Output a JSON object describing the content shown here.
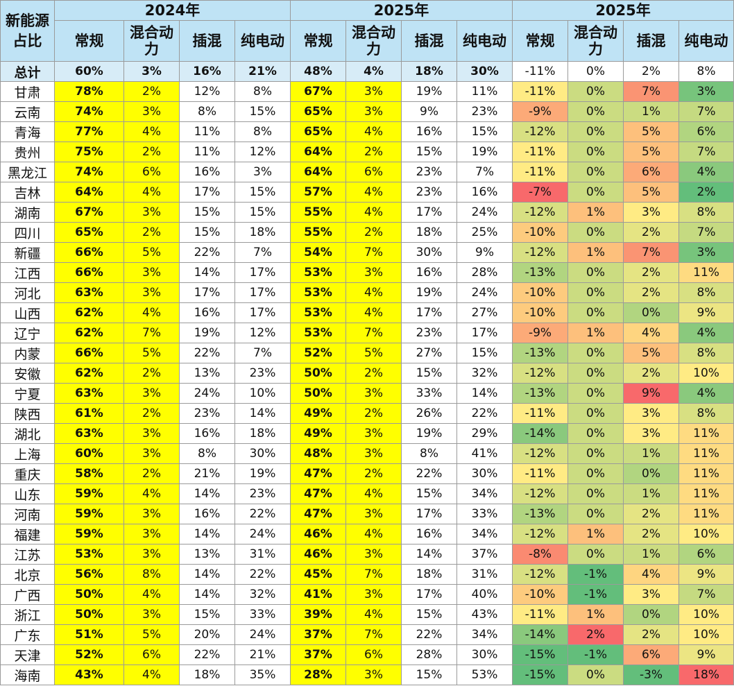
{
  "table": {
    "corner_label": "新能源占比",
    "group_headers": [
      "2024年",
      "2025年",
      "2025年"
    ],
    "sub_headers": [
      "常规",
      "混合动力",
      "插混",
      "纯电动",
      "常规",
      "混合动力",
      "插混",
      "纯电动",
      "常规",
      "混合动力",
      "插混",
      "纯电动"
    ],
    "total": {
      "label": "总计",
      "values": [
        "60%",
        "3%",
        "16%",
        "21%",
        "48%",
        "4%",
        "18%",
        "30%",
        "-11%",
        "0%",
        "2%",
        "8%"
      ]
    },
    "rows": [
      {
        "province": "甘肃",
        "values": [
          "78%",
          "2%",
          "12%",
          "8%",
          "67%",
          "3%",
          "19%",
          "11%",
          "-11%",
          "0%",
          "7%",
          "3%"
        ]
      },
      {
        "province": "云南",
        "values": [
          "74%",
          "3%",
          "8%",
          "15%",
          "65%",
          "3%",
          "9%",
          "23%",
          "-9%",
          "0%",
          "1%",
          "7%"
        ]
      },
      {
        "province": "青海",
        "values": [
          "77%",
          "4%",
          "11%",
          "8%",
          "65%",
          "4%",
          "16%",
          "15%",
          "-12%",
          "0%",
          "5%",
          "6%"
        ]
      },
      {
        "province": "贵州",
        "values": [
          "75%",
          "2%",
          "11%",
          "12%",
          "64%",
          "2%",
          "15%",
          "19%",
          "-11%",
          "0%",
          "5%",
          "7%"
        ]
      },
      {
        "province": "黑龙江",
        "values": [
          "74%",
          "6%",
          "16%",
          "3%",
          "64%",
          "6%",
          "23%",
          "7%",
          "-11%",
          "0%",
          "6%",
          "4%"
        ]
      },
      {
        "province": "吉林",
        "values": [
          "64%",
          "4%",
          "17%",
          "15%",
          "57%",
          "4%",
          "23%",
          "16%",
          "-7%",
          "0%",
          "5%",
          "2%"
        ]
      },
      {
        "province": "湖南",
        "values": [
          "67%",
          "3%",
          "15%",
          "15%",
          "55%",
          "4%",
          "17%",
          "24%",
          "-12%",
          "1%",
          "3%",
          "8%"
        ]
      },
      {
        "province": "四川",
        "values": [
          "65%",
          "2%",
          "15%",
          "18%",
          "55%",
          "2%",
          "18%",
          "25%",
          "-10%",
          "0%",
          "2%",
          "7%"
        ]
      },
      {
        "province": "新疆",
        "values": [
          "66%",
          "5%",
          "22%",
          "7%",
          "54%",
          "7%",
          "30%",
          "9%",
          "-12%",
          "1%",
          "7%",
          "3%"
        ]
      },
      {
        "province": "江西",
        "values": [
          "66%",
          "3%",
          "14%",
          "17%",
          "53%",
          "3%",
          "16%",
          "28%",
          "-13%",
          "0%",
          "2%",
          "11%"
        ]
      },
      {
        "province": "河北",
        "values": [
          "63%",
          "3%",
          "17%",
          "17%",
          "53%",
          "4%",
          "19%",
          "24%",
          "-10%",
          "0%",
          "2%",
          "8%"
        ]
      },
      {
        "province": "山西",
        "values": [
          "62%",
          "4%",
          "16%",
          "17%",
          "53%",
          "4%",
          "17%",
          "27%",
          "-10%",
          "0%",
          "0%",
          "9%"
        ]
      },
      {
        "province": "辽宁",
        "values": [
          "62%",
          "7%",
          "19%",
          "12%",
          "53%",
          "7%",
          "23%",
          "17%",
          "-9%",
          "1%",
          "4%",
          "4%"
        ]
      },
      {
        "province": "内蒙",
        "values": [
          "66%",
          "5%",
          "22%",
          "7%",
          "52%",
          "5%",
          "27%",
          "15%",
          "-13%",
          "0%",
          "5%",
          "8%"
        ]
      },
      {
        "province": "安徽",
        "values": [
          "62%",
          "2%",
          "13%",
          "23%",
          "50%",
          "2%",
          "15%",
          "32%",
          "-12%",
          "0%",
          "2%",
          "10%"
        ]
      },
      {
        "province": "宁夏",
        "values": [
          "63%",
          "3%",
          "24%",
          "10%",
          "50%",
          "3%",
          "33%",
          "14%",
          "-13%",
          "0%",
          "9%",
          "4%"
        ]
      },
      {
        "province": "陕西",
        "values": [
          "61%",
          "2%",
          "23%",
          "14%",
          "49%",
          "2%",
          "26%",
          "22%",
          "-11%",
          "0%",
          "3%",
          "8%"
        ]
      },
      {
        "province": "湖北",
        "values": [
          "63%",
          "3%",
          "16%",
          "18%",
          "49%",
          "3%",
          "19%",
          "29%",
          "-14%",
          "0%",
          "3%",
          "11%"
        ]
      },
      {
        "province": "上海",
        "values": [
          "60%",
          "3%",
          "8%",
          "30%",
          "48%",
          "3%",
          "8%",
          "41%",
          "-12%",
          "0%",
          "1%",
          "11%"
        ]
      },
      {
        "province": "重庆",
        "values": [
          "58%",
          "2%",
          "21%",
          "19%",
          "47%",
          "2%",
          "22%",
          "30%",
          "-11%",
          "0%",
          "0%",
          "11%"
        ]
      },
      {
        "province": "山东",
        "values": [
          "59%",
          "4%",
          "14%",
          "23%",
          "47%",
          "4%",
          "15%",
          "34%",
          "-12%",
          "0%",
          "1%",
          "11%"
        ]
      },
      {
        "province": "河南",
        "values": [
          "59%",
          "3%",
          "16%",
          "22%",
          "47%",
          "3%",
          "17%",
          "33%",
          "-13%",
          "0%",
          "2%",
          "11%"
        ]
      },
      {
        "province": "福建",
        "values": [
          "59%",
          "3%",
          "14%",
          "24%",
          "46%",
          "4%",
          "16%",
          "34%",
          "-12%",
          "1%",
          "2%",
          "10%"
        ]
      },
      {
        "province": "江苏",
        "values": [
          "53%",
          "3%",
          "13%",
          "31%",
          "46%",
          "3%",
          "14%",
          "37%",
          "-8%",
          "0%",
          "1%",
          "6%"
        ]
      },
      {
        "province": "北京",
        "values": [
          "56%",
          "8%",
          "14%",
          "22%",
          "45%",
          "7%",
          "18%",
          "31%",
          "-12%",
          "-1%",
          "4%",
          "9%"
        ]
      },
      {
        "province": "广西",
        "values": [
          "50%",
          "4%",
          "14%",
          "32%",
          "41%",
          "3%",
          "17%",
          "40%",
          "-10%",
          "-1%",
          "3%",
          "7%"
        ]
      },
      {
        "province": "浙江",
        "values": [
          "50%",
          "3%",
          "15%",
          "33%",
          "39%",
          "4%",
          "15%",
          "43%",
          "-11%",
          "1%",
          "0%",
          "10%"
        ]
      },
      {
        "province": "广东",
        "values": [
          "51%",
          "5%",
          "20%",
          "24%",
          "37%",
          "7%",
          "22%",
          "34%",
          "-14%",
          "2%",
          "2%",
          "10%"
        ]
      },
      {
        "province": "天津",
        "values": [
          "52%",
          "6%",
          "22%",
          "21%",
          "37%",
          "6%",
          "28%",
          "30%",
          "-15%",
          "-1%",
          "6%",
          "9%"
        ]
      },
      {
        "province": "海南",
        "values": [
          "43%",
          "4%",
          "18%",
          "35%",
          "28%",
          "3%",
          "15%",
          "53%",
          "-15%",
          "0%",
          "-3%",
          "18%"
        ]
      }
    ],
    "colors": {
      "header_bg": "#bfe3f5",
      "total_bg": "#d7ecf7",
      "highlight_yellow": "#ffff00",
      "heat_low": "#63be7b",
      "heat_mid": "#ffeb84",
      "heat_high": "#f8696b"
    }
  }
}
